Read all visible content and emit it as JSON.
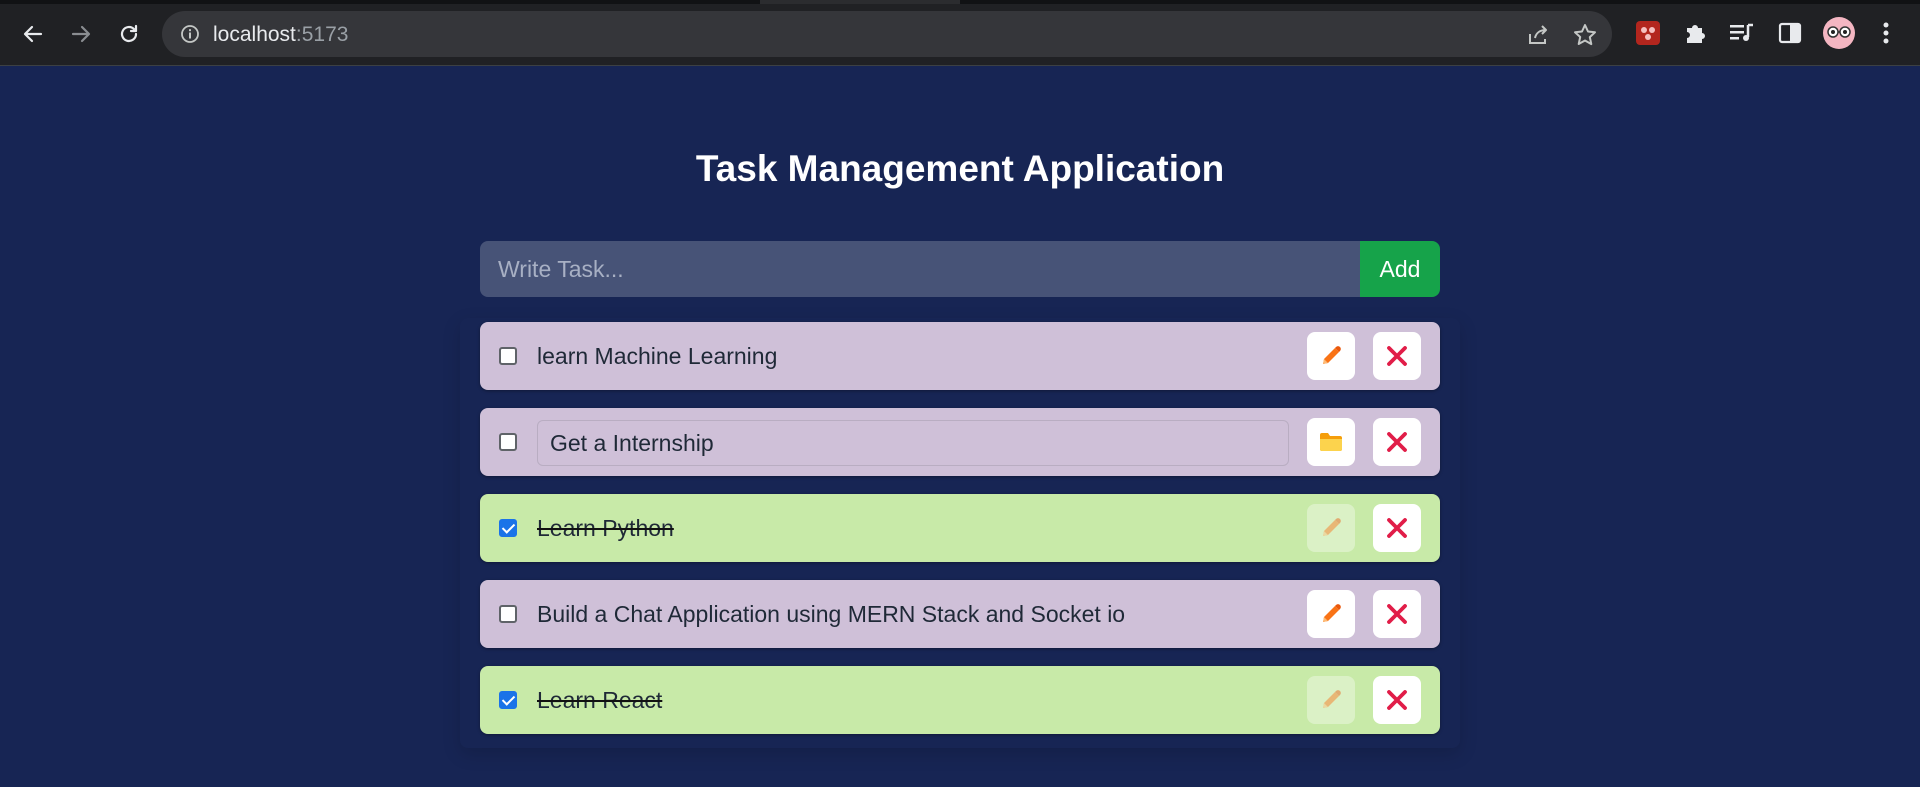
{
  "browser": {
    "url_host": "localhost",
    "url_port": ":5173"
  },
  "app": {
    "title": "Task Management Application",
    "input_placeholder": "Write Task...",
    "add_label": "Add"
  },
  "tasks": [
    {
      "text": "learn Machine Learning",
      "completed": false,
      "editing": false
    },
    {
      "text": "Get a Internship",
      "completed": false,
      "editing": true
    },
    {
      "text": "Learn Python",
      "completed": true,
      "editing": false
    },
    {
      "text": "Build a Chat Application using MERN Stack and Socket io",
      "completed": false,
      "editing": false
    },
    {
      "text": "Learn React",
      "completed": true,
      "editing": false
    }
  ],
  "colors": {
    "background": "#172554",
    "pending_task": "#cfc0d8",
    "completed_task": "#c8eaa8",
    "add_button": "#16a34a",
    "delete_icon": "#e11d48",
    "edit_icon": "#f97316",
    "save_icon": "#fbbf24"
  },
  "icons": {
    "edit": "pencil-icon",
    "save": "folder-icon",
    "delete": "x-icon"
  }
}
